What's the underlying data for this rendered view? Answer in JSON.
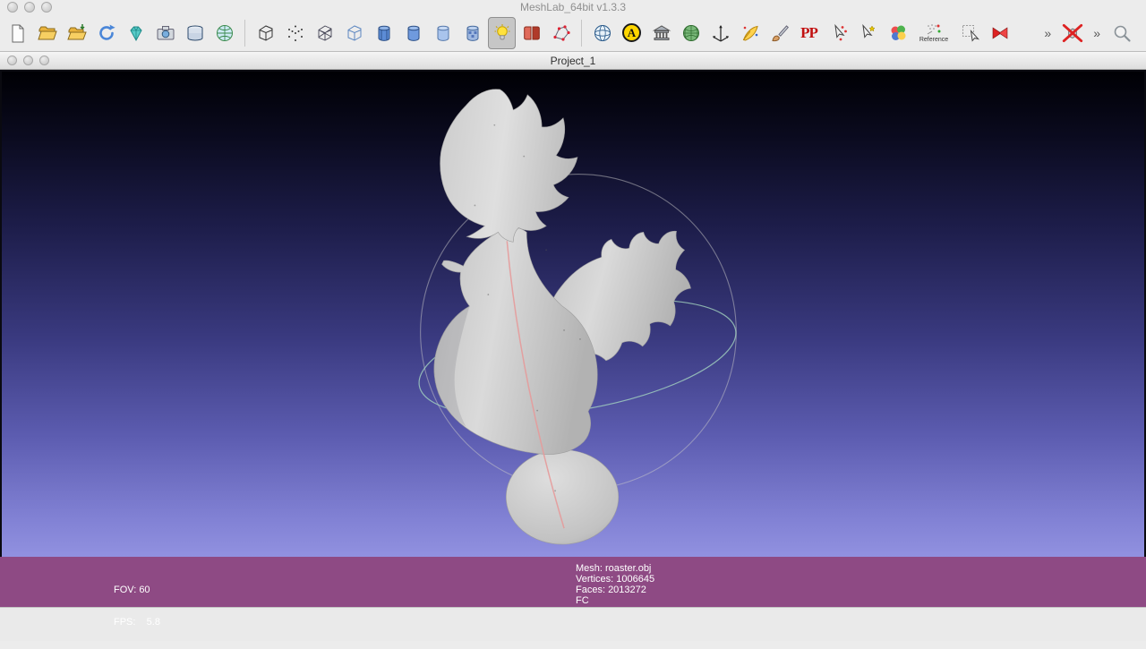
{
  "window": {
    "title": "MeshLab_64bit v1.3.3"
  },
  "project_window": {
    "title": "Project_1"
  },
  "toolbar": {
    "a_icon_label": "A",
    "pp_icon_label": "PP",
    "reference_label": "Reference",
    "overflow_chevron": "»"
  },
  "statusbar": {
    "fov": "FOV: 60",
    "fps": "FPS:    5.8",
    "mesh": "Mesh: roaster.obj",
    "vertices": "Vertices: 1006645",
    "faces": "Faces: 2013272",
    "flags": "FC"
  },
  "colors": {
    "statusbar_bg": "#8e4a84",
    "viewport_gradient_top": "#000004",
    "viewport_gradient_bottom": "#9191e0",
    "trackball_horizontal": "#a9dcc3",
    "trackball_vertical": "#e59a9a",
    "trackball_sphere": "#c9c9c9",
    "model_gray": "#cccccc"
  }
}
